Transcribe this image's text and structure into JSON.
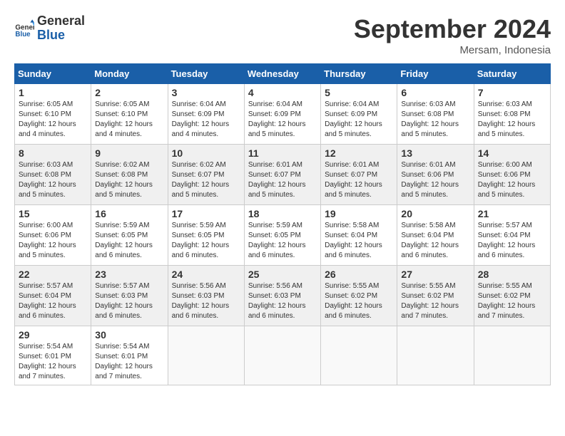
{
  "logo": {
    "line1": "General",
    "line2": "Blue"
  },
  "title": "September 2024",
  "location": "Mersam, Indonesia",
  "days_header": [
    "Sunday",
    "Monday",
    "Tuesday",
    "Wednesday",
    "Thursday",
    "Friday",
    "Saturday"
  ],
  "weeks": [
    [
      {
        "num": "1",
        "sunrise": "6:05 AM",
        "sunset": "6:10 PM",
        "daylight": "12 hours and 4 minutes."
      },
      {
        "num": "2",
        "sunrise": "6:05 AM",
        "sunset": "6:10 PM",
        "daylight": "12 hours and 4 minutes."
      },
      {
        "num": "3",
        "sunrise": "6:04 AM",
        "sunset": "6:09 PM",
        "daylight": "12 hours and 4 minutes."
      },
      {
        "num": "4",
        "sunrise": "6:04 AM",
        "sunset": "6:09 PM",
        "daylight": "12 hours and 5 minutes."
      },
      {
        "num": "5",
        "sunrise": "6:04 AM",
        "sunset": "6:09 PM",
        "daylight": "12 hours and 5 minutes."
      },
      {
        "num": "6",
        "sunrise": "6:03 AM",
        "sunset": "6:08 PM",
        "daylight": "12 hours and 5 minutes."
      },
      {
        "num": "7",
        "sunrise": "6:03 AM",
        "sunset": "6:08 PM",
        "daylight": "12 hours and 5 minutes."
      }
    ],
    [
      {
        "num": "8",
        "sunrise": "6:03 AM",
        "sunset": "6:08 PM",
        "daylight": "12 hours and 5 minutes."
      },
      {
        "num": "9",
        "sunrise": "6:02 AM",
        "sunset": "6:08 PM",
        "daylight": "12 hours and 5 minutes."
      },
      {
        "num": "10",
        "sunrise": "6:02 AM",
        "sunset": "6:07 PM",
        "daylight": "12 hours and 5 minutes."
      },
      {
        "num": "11",
        "sunrise": "6:01 AM",
        "sunset": "6:07 PM",
        "daylight": "12 hours and 5 minutes."
      },
      {
        "num": "12",
        "sunrise": "6:01 AM",
        "sunset": "6:07 PM",
        "daylight": "12 hours and 5 minutes."
      },
      {
        "num": "13",
        "sunrise": "6:01 AM",
        "sunset": "6:06 PM",
        "daylight": "12 hours and 5 minutes."
      },
      {
        "num": "14",
        "sunrise": "6:00 AM",
        "sunset": "6:06 PM",
        "daylight": "12 hours and 5 minutes."
      }
    ],
    [
      {
        "num": "15",
        "sunrise": "6:00 AM",
        "sunset": "6:06 PM",
        "daylight": "12 hours and 5 minutes."
      },
      {
        "num": "16",
        "sunrise": "5:59 AM",
        "sunset": "6:05 PM",
        "daylight": "12 hours and 6 minutes."
      },
      {
        "num": "17",
        "sunrise": "5:59 AM",
        "sunset": "6:05 PM",
        "daylight": "12 hours and 6 minutes."
      },
      {
        "num": "18",
        "sunrise": "5:59 AM",
        "sunset": "6:05 PM",
        "daylight": "12 hours and 6 minutes."
      },
      {
        "num": "19",
        "sunrise": "5:58 AM",
        "sunset": "6:04 PM",
        "daylight": "12 hours and 6 minutes."
      },
      {
        "num": "20",
        "sunrise": "5:58 AM",
        "sunset": "6:04 PM",
        "daylight": "12 hours and 6 minutes."
      },
      {
        "num": "21",
        "sunrise": "5:57 AM",
        "sunset": "6:04 PM",
        "daylight": "12 hours and 6 minutes."
      }
    ],
    [
      {
        "num": "22",
        "sunrise": "5:57 AM",
        "sunset": "6:04 PM",
        "daylight": "12 hours and 6 minutes."
      },
      {
        "num": "23",
        "sunrise": "5:57 AM",
        "sunset": "6:03 PM",
        "daylight": "12 hours and 6 minutes."
      },
      {
        "num": "24",
        "sunrise": "5:56 AM",
        "sunset": "6:03 PM",
        "daylight": "12 hours and 6 minutes."
      },
      {
        "num": "25",
        "sunrise": "5:56 AM",
        "sunset": "6:03 PM",
        "daylight": "12 hours and 6 minutes."
      },
      {
        "num": "26",
        "sunrise": "5:55 AM",
        "sunset": "6:02 PM",
        "daylight": "12 hours and 6 minutes."
      },
      {
        "num": "27",
        "sunrise": "5:55 AM",
        "sunset": "6:02 PM",
        "daylight": "12 hours and 7 minutes."
      },
      {
        "num": "28",
        "sunrise": "5:55 AM",
        "sunset": "6:02 PM",
        "daylight": "12 hours and 7 minutes."
      }
    ],
    [
      {
        "num": "29",
        "sunrise": "5:54 AM",
        "sunset": "6:01 PM",
        "daylight": "12 hours and 7 minutes."
      },
      {
        "num": "30",
        "sunrise": "5:54 AM",
        "sunset": "6:01 PM",
        "daylight": "12 hours and 7 minutes."
      },
      null,
      null,
      null,
      null,
      null
    ]
  ]
}
